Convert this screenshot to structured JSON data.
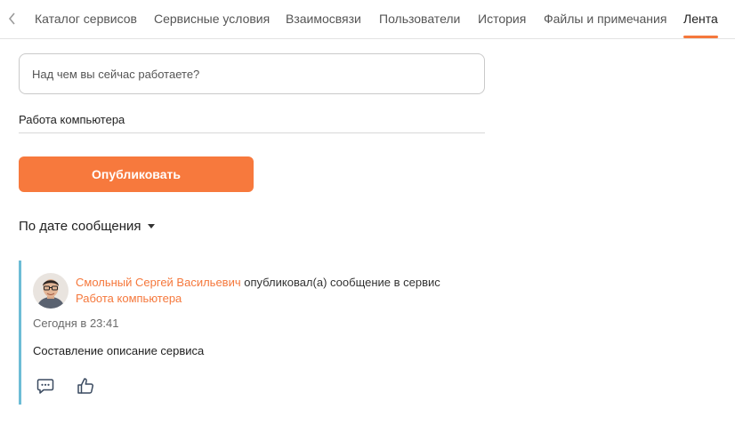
{
  "tabs": [
    {
      "label": "Каталог сервисов",
      "active": false
    },
    {
      "label": "Сервисные условия",
      "active": false
    },
    {
      "label": "Взаимосвязи",
      "active": false
    },
    {
      "label": "Пользователи",
      "active": false
    },
    {
      "label": "История",
      "active": false
    },
    {
      "label": "Файлы и примечания",
      "active": false
    },
    {
      "label": "Лента",
      "active": true
    }
  ],
  "composer": {
    "placeholder": "Над чем вы сейчас работаете?",
    "service": "Работа компьютера",
    "publish_label": "Опубликовать"
  },
  "sort": {
    "label": "По дате сообщения"
  },
  "feed": [
    {
      "author": "Смольный Сергей Васильевич",
      "action_text": "опубликовал(а) сообщение в сервис",
      "service": "Работа компьютера",
      "time": "Сегодня в 23:41",
      "message": "Составление описание сервиса"
    }
  ],
  "icons": {
    "back": "chevron-left-icon",
    "comment": "comment-icon",
    "like": "thumbs-up-icon",
    "sort": "caret-down-icon"
  },
  "colors": {
    "accent": "#f7793d",
    "feed_border": "#6dbcd6"
  }
}
